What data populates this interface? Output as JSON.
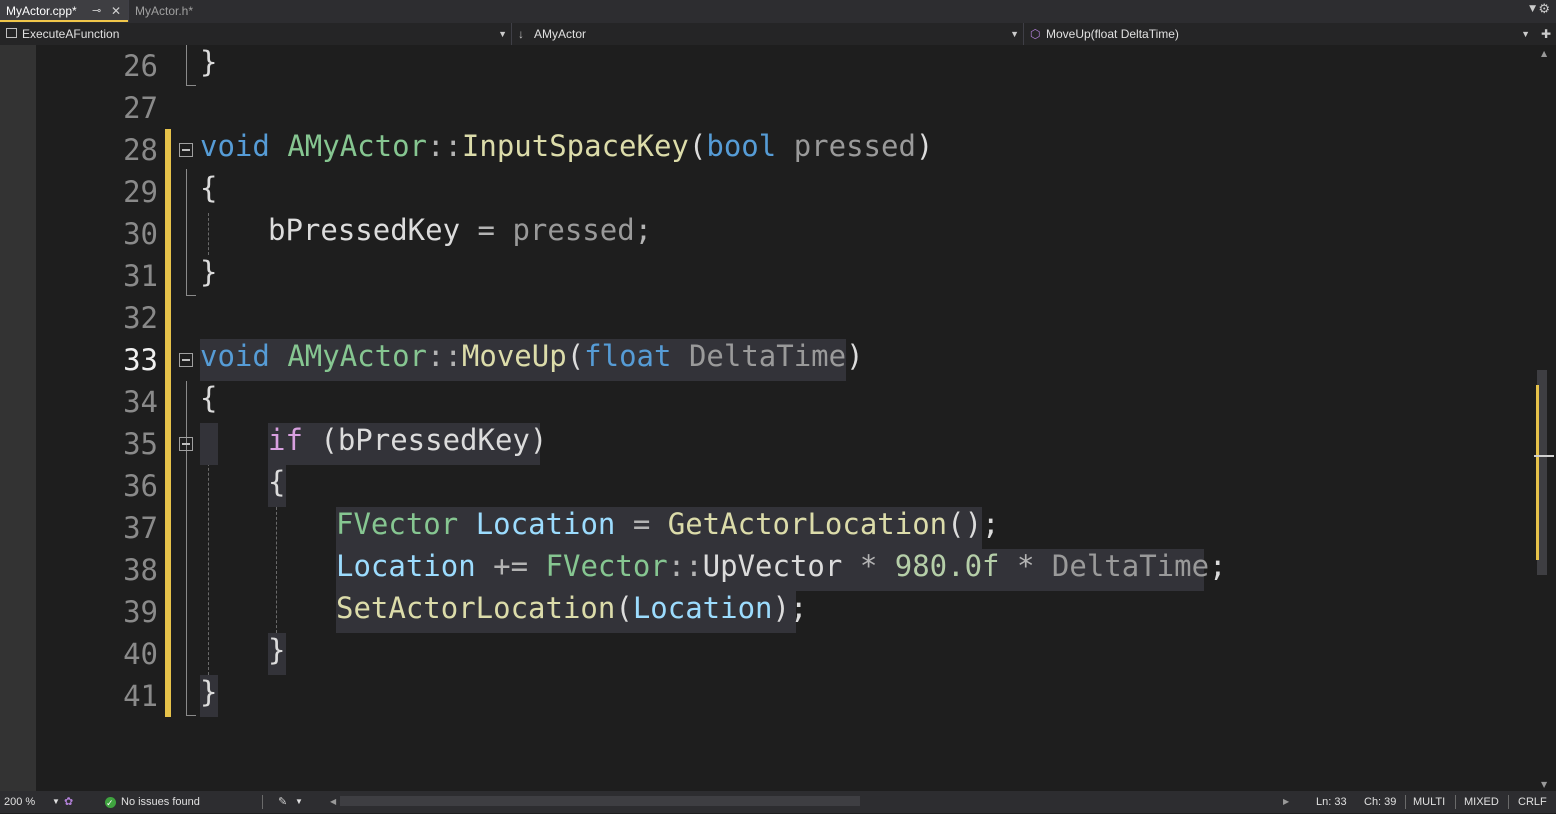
{
  "tabs": [
    {
      "label": "MyActor.cpp*",
      "active": true,
      "pin_icon": "pin-icon",
      "close_icon": "close-icon"
    },
    {
      "label": "MyActor.h*",
      "active": false
    }
  ],
  "navbar": {
    "project": "ExecuteAFunction",
    "scope": "AMyActor",
    "member": "MoveUp(float DeltaTime)"
  },
  "editor": {
    "current_line": 33,
    "line_numbers": [
      "26",
      "27",
      "28",
      "29",
      "30",
      "31",
      "32",
      "33",
      "34",
      "35",
      "36",
      "37",
      "38",
      "39",
      "40",
      "41"
    ],
    "code": {
      "l26": "}",
      "l28": {
        "kw": "void",
        "cls": "AMyActor",
        "sep": "::",
        "fn": "InputSpaceKey",
        "open": "(",
        "ptype": "bool",
        "pname": "pressed",
        "close": ")"
      },
      "l29": "{",
      "l30": {
        "lhs": "bPressedKey",
        "op": " = ",
        "rhs": "pressed",
        "end": ";"
      },
      "l31": "}",
      "l33": {
        "kw": "void",
        "cls": "AMyActor",
        "sep": "::",
        "fn": "MoveUp",
        "open": "(",
        "ptype": "float",
        "pname": "DeltaTime",
        "close": ")"
      },
      "l34": "{",
      "l35": {
        "kw": "if",
        "rest": " (bPressedKey)"
      },
      "l36": "{",
      "l37": {
        "cls": "FVector",
        "var": "Location",
        "op": " = ",
        "fn": "GetActorLocation",
        "end": "();"
      },
      "l38": {
        "var": "Location",
        "op": " += ",
        "cls": "FVector",
        "sep": "::",
        "member": "UpVector",
        "mul": " * ",
        "num": "980.0f",
        "mul2": " * ",
        "pname": "DeltaTime",
        "end": ";"
      },
      "l39": {
        "fn": "SetActorLocation",
        "open": "(",
        "var": "Location",
        "end": ");"
      },
      "l40": "}",
      "l41": "}"
    }
  },
  "status": {
    "zoom": "200 %",
    "issues": "No issues found",
    "ln": "Ln: 33",
    "ch": "Ch: 39",
    "mode": "MULTI",
    "indent": "MIXED",
    "eol": "CRLF"
  },
  "colors": {
    "accent_change": "#e6c24a",
    "keyword": "#569cd6",
    "class": "#86c691",
    "function": "#dcdcaa",
    "variable": "#9cdcfe",
    "ok": "#3fa33f"
  }
}
